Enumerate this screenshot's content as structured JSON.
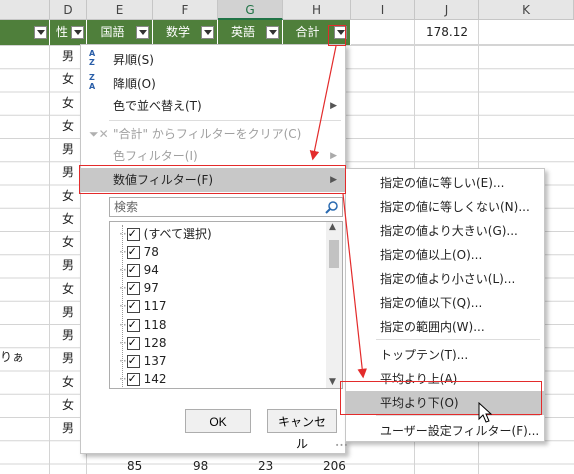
{
  "columns": [
    "D",
    "E",
    "F",
    "G",
    "H",
    "I",
    "J",
    "K"
  ],
  "header_cells": {
    "sex": "性",
    "kokugo": "国語",
    "sugaku": "数学",
    "eigo": "英語",
    "gokei": "合計"
  },
  "j1_value": "178.12",
  "left_row_text": "りぁ",
  "sex_values": [
    "男",
    "女",
    "女",
    "女",
    "男",
    "男",
    "女",
    "女",
    "女",
    "男",
    "女",
    "男",
    "男",
    "りぁ",
    "男",
    "女",
    "女",
    "男"
  ],
  "sex_column": [
    "男",
    "女",
    "女",
    "女",
    "男",
    "男",
    "女",
    "女",
    "女",
    "男",
    "女",
    "男",
    "男",
    "男",
    "女",
    "女",
    "男"
  ],
  "bottom_row": {
    "sex": "男",
    "e": "85",
    "f": "98",
    "g": "23",
    "h": "206"
  },
  "filter_menu": {
    "sort_asc": "昇順(S)",
    "sort_desc": "降順(O)",
    "sort_color": "色で並べ替え(T)",
    "clear_filter": "\"合計\" からフィルターをクリア(C)",
    "color_filter": "色フィルター(I)",
    "number_filter": "数値フィルター(F)",
    "search_placeholder": "検索",
    "items": [
      "(すべて選択)",
      "78",
      "94",
      "97",
      "117",
      "118",
      "128",
      "137",
      "142"
    ],
    "ok": "OK",
    "cancel": "キャンセル"
  },
  "submenu": [
    "指定の値に等しい(E)...",
    "指定の値に等しくない(N)...",
    "指定の値より大きい(G)...",
    "指定の値以上(O)...",
    "指定の値より小さい(L)...",
    "指定の値以下(Q)...",
    "指定の範囲内(W)...",
    "トップテン(T)...",
    "平均より上(A)",
    "平均より下(O)",
    "ユーザー設定フィルター(F)..."
  ],
  "colors": {
    "header_green": "#4f7f3b",
    "highlight": "#c8c8c8",
    "annotation_red": "#e32b2b"
  },
  "icons": [
    "sort-asc-icon",
    "sort-desc-icon",
    "clear-filter-icon",
    "search-icon",
    "dropdown-icon",
    "cursor-icon"
  ]
}
